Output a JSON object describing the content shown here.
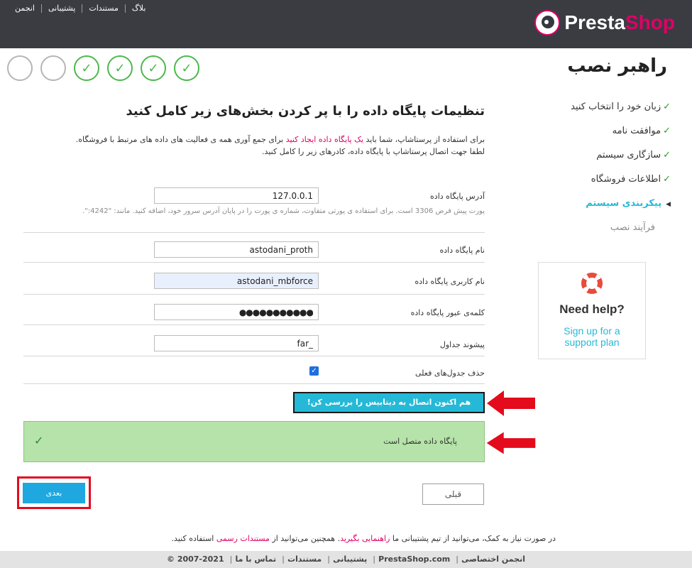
{
  "topbar": {
    "links": [
      "انجمن",
      "پشتیبانی",
      "مستندات",
      "بلاگ"
    ],
    "logo_part1": "Presta",
    "logo_part2": "Shop",
    "brand_color": "#df0067",
    "bg_color": "#3a3c42"
  },
  "steps": [
    {
      "state": "done",
      "icon": "check-icon"
    },
    {
      "state": "done",
      "icon": "check-icon"
    },
    {
      "state": "done",
      "icon": "check-icon"
    },
    {
      "state": "done",
      "icon": "check-icon"
    },
    {
      "state": "pending",
      "icon": "circle-icon"
    },
    {
      "state": "pending",
      "icon": "circle-icon"
    }
  ],
  "wizard_title": "راهبر نصب",
  "menu": {
    "items": [
      {
        "label": "زبان خود را انتخاب کنید",
        "state": "done"
      },
      {
        "label": "موافقت نامه",
        "state": "done"
      },
      {
        "label": "سازگاری سیستم",
        "state": "done"
      },
      {
        "label": "اطلاعات فروشگاه",
        "state": "done"
      },
      {
        "label": "پیکربندی سیستم",
        "state": "active"
      },
      {
        "label": "فرآیند نصب",
        "state": "pending"
      }
    ],
    "check_glyph": "✓",
    "active_glyph": "◀"
  },
  "help": {
    "question": "Need help?",
    "link_line1": "Sign up for a",
    "link_line2": "support plan"
  },
  "main": {
    "heading": "تنظیمات پایگاه داده را با پر کردن بخش‌های زیر کامل کنید",
    "intro_before": "برای استفاده از پرستاشاپ، شما باید ",
    "intro_link": "یک پایگاه داده ایجاد کنید",
    "intro_after": " برای جمع آوری همه ی فعالیت های داده های مرتبط با فروشگاه.",
    "intro_line2": "لطفا جهت اتصال پرستاشاپ با پایگاه داده، کادرهای زیر را کامل کنید."
  },
  "form": {
    "address_label": "آدرس پایگاه داده",
    "address_value": "127.0.0.1",
    "address_hint": "پورت پیش فرض 3306 است. برای استفاده ی پورتی متفاوت، شماره ی پورت را در پایان آدرس سرور خود، اضافه کنید. مانند: \"4242:\".",
    "dbname_label": "نام پایگاه داده",
    "dbname_value": "astodani_proth",
    "user_label": "نام کاربری پایگاه داده",
    "user_value": "astodani_mbforce",
    "password_label": "کلمه‌ی عبور پایگاه داده",
    "password_value": "●●●●●●●●●●●",
    "prefix_label": "پیشوند جداول",
    "prefix_value": "far_",
    "drop_label": "حذف جدول‌های فعلی",
    "drop_checked": "✓"
  },
  "check_button_label": "هم اکنون اتصال به دیتابیس را بررسی کن!",
  "success": {
    "message": "پایگاه داده متصل است",
    "tick": "✓"
  },
  "nav": {
    "prev_label": "قبلی",
    "next_label": "بعدی"
  },
  "footnote": {
    "before": "در صورت نیاز به کمک، می‌توانید از تیم پشتیبانی ما ",
    "link1": "راهنمایی بگیرید",
    "middle": ". همچنین می‌توانید از ",
    "link2": "مستندات رسمی",
    "after": " استفاده کنید."
  },
  "footer": {
    "items": [
      "انجمن اختصاصی",
      "PrestaShop.com",
      "پشتیبانی",
      "مستندات",
      "تماس با ما",
      "© 2007-2021"
    ]
  },
  "colors": {
    "accent": "#25b9d7",
    "success_bg": "#b5e3a9",
    "annotation_red": "#e30b1c",
    "check_green": "#4cb84c"
  }
}
